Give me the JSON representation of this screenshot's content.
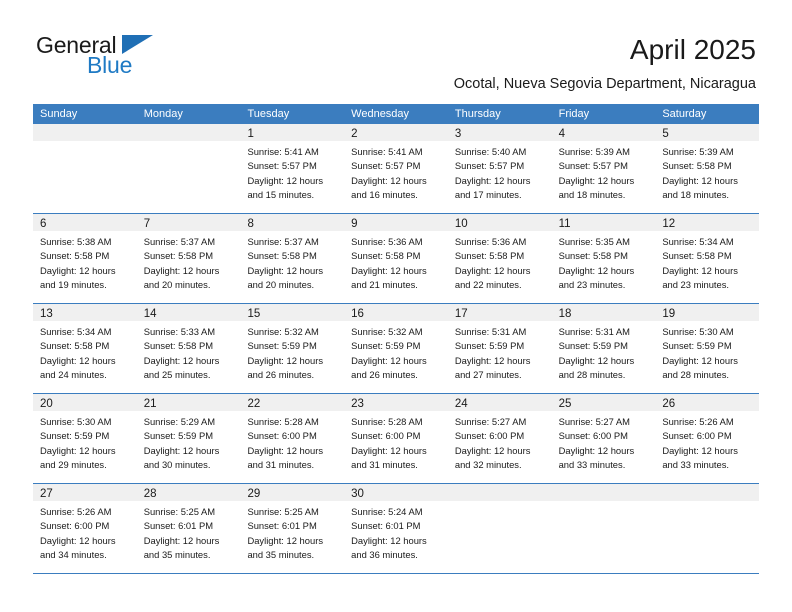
{
  "brand": {
    "name_part1": "General",
    "name_part2": "Blue",
    "triangle_icon": "triangle-icon",
    "color_dark": "#1a1a1a",
    "color_blue": "#1f7ac4"
  },
  "header": {
    "title": "April 2025",
    "subtitle": "Ocotal, Nueva Segovia Department, Nicaragua"
  },
  "theme": {
    "header_blue": "#3b7dbf",
    "daynum_band": "#f0f0f0",
    "text": "#1a1a1a"
  },
  "weekdays": [
    "Sunday",
    "Monday",
    "Tuesday",
    "Wednesday",
    "Thursday",
    "Friday",
    "Saturday"
  ],
  "weeks": [
    [
      {
        "day": "",
        "sunrise": "",
        "sunset": "",
        "daylight1": "",
        "daylight2": ""
      },
      {
        "day": "",
        "sunrise": "",
        "sunset": "",
        "daylight1": "",
        "daylight2": ""
      },
      {
        "day": "1",
        "sunrise": "Sunrise: 5:41 AM",
        "sunset": "Sunset: 5:57 PM",
        "daylight1": "Daylight: 12 hours",
        "daylight2": "and 15 minutes."
      },
      {
        "day": "2",
        "sunrise": "Sunrise: 5:41 AM",
        "sunset": "Sunset: 5:57 PM",
        "daylight1": "Daylight: 12 hours",
        "daylight2": "and 16 minutes."
      },
      {
        "day": "3",
        "sunrise": "Sunrise: 5:40 AM",
        "sunset": "Sunset: 5:57 PM",
        "daylight1": "Daylight: 12 hours",
        "daylight2": "and 17 minutes."
      },
      {
        "day": "4",
        "sunrise": "Sunrise: 5:39 AM",
        "sunset": "Sunset: 5:57 PM",
        "daylight1": "Daylight: 12 hours",
        "daylight2": "and 18 minutes."
      },
      {
        "day": "5",
        "sunrise": "Sunrise: 5:39 AM",
        "sunset": "Sunset: 5:58 PM",
        "daylight1": "Daylight: 12 hours",
        "daylight2": "and 18 minutes."
      }
    ],
    [
      {
        "day": "6",
        "sunrise": "Sunrise: 5:38 AM",
        "sunset": "Sunset: 5:58 PM",
        "daylight1": "Daylight: 12 hours",
        "daylight2": "and 19 minutes."
      },
      {
        "day": "7",
        "sunrise": "Sunrise: 5:37 AM",
        "sunset": "Sunset: 5:58 PM",
        "daylight1": "Daylight: 12 hours",
        "daylight2": "and 20 minutes."
      },
      {
        "day": "8",
        "sunrise": "Sunrise: 5:37 AM",
        "sunset": "Sunset: 5:58 PM",
        "daylight1": "Daylight: 12 hours",
        "daylight2": "and 20 minutes."
      },
      {
        "day": "9",
        "sunrise": "Sunrise: 5:36 AM",
        "sunset": "Sunset: 5:58 PM",
        "daylight1": "Daylight: 12 hours",
        "daylight2": "and 21 minutes."
      },
      {
        "day": "10",
        "sunrise": "Sunrise: 5:36 AM",
        "sunset": "Sunset: 5:58 PM",
        "daylight1": "Daylight: 12 hours",
        "daylight2": "and 22 minutes."
      },
      {
        "day": "11",
        "sunrise": "Sunrise: 5:35 AM",
        "sunset": "Sunset: 5:58 PM",
        "daylight1": "Daylight: 12 hours",
        "daylight2": "and 23 minutes."
      },
      {
        "day": "12",
        "sunrise": "Sunrise: 5:34 AM",
        "sunset": "Sunset: 5:58 PM",
        "daylight1": "Daylight: 12 hours",
        "daylight2": "and 23 minutes."
      }
    ],
    [
      {
        "day": "13",
        "sunrise": "Sunrise: 5:34 AM",
        "sunset": "Sunset: 5:58 PM",
        "daylight1": "Daylight: 12 hours",
        "daylight2": "and 24 minutes."
      },
      {
        "day": "14",
        "sunrise": "Sunrise: 5:33 AM",
        "sunset": "Sunset: 5:58 PM",
        "daylight1": "Daylight: 12 hours",
        "daylight2": "and 25 minutes."
      },
      {
        "day": "15",
        "sunrise": "Sunrise: 5:32 AM",
        "sunset": "Sunset: 5:59 PM",
        "daylight1": "Daylight: 12 hours",
        "daylight2": "and 26 minutes."
      },
      {
        "day": "16",
        "sunrise": "Sunrise: 5:32 AM",
        "sunset": "Sunset: 5:59 PM",
        "daylight1": "Daylight: 12 hours",
        "daylight2": "and 26 minutes."
      },
      {
        "day": "17",
        "sunrise": "Sunrise: 5:31 AM",
        "sunset": "Sunset: 5:59 PM",
        "daylight1": "Daylight: 12 hours",
        "daylight2": "and 27 minutes."
      },
      {
        "day": "18",
        "sunrise": "Sunrise: 5:31 AM",
        "sunset": "Sunset: 5:59 PM",
        "daylight1": "Daylight: 12 hours",
        "daylight2": "and 28 minutes."
      },
      {
        "day": "19",
        "sunrise": "Sunrise: 5:30 AM",
        "sunset": "Sunset: 5:59 PM",
        "daylight1": "Daylight: 12 hours",
        "daylight2": "and 28 minutes."
      }
    ],
    [
      {
        "day": "20",
        "sunrise": "Sunrise: 5:30 AM",
        "sunset": "Sunset: 5:59 PM",
        "daylight1": "Daylight: 12 hours",
        "daylight2": "and 29 minutes."
      },
      {
        "day": "21",
        "sunrise": "Sunrise: 5:29 AM",
        "sunset": "Sunset: 5:59 PM",
        "daylight1": "Daylight: 12 hours",
        "daylight2": "and 30 minutes."
      },
      {
        "day": "22",
        "sunrise": "Sunrise: 5:28 AM",
        "sunset": "Sunset: 6:00 PM",
        "daylight1": "Daylight: 12 hours",
        "daylight2": "and 31 minutes."
      },
      {
        "day": "23",
        "sunrise": "Sunrise: 5:28 AM",
        "sunset": "Sunset: 6:00 PM",
        "daylight1": "Daylight: 12 hours",
        "daylight2": "and 31 minutes."
      },
      {
        "day": "24",
        "sunrise": "Sunrise: 5:27 AM",
        "sunset": "Sunset: 6:00 PM",
        "daylight1": "Daylight: 12 hours",
        "daylight2": "and 32 minutes."
      },
      {
        "day": "25",
        "sunrise": "Sunrise: 5:27 AM",
        "sunset": "Sunset: 6:00 PM",
        "daylight1": "Daylight: 12 hours",
        "daylight2": "and 33 minutes."
      },
      {
        "day": "26",
        "sunrise": "Sunrise: 5:26 AM",
        "sunset": "Sunset: 6:00 PM",
        "daylight1": "Daylight: 12 hours",
        "daylight2": "and 33 minutes."
      }
    ],
    [
      {
        "day": "27",
        "sunrise": "Sunrise: 5:26 AM",
        "sunset": "Sunset: 6:00 PM",
        "daylight1": "Daylight: 12 hours",
        "daylight2": "and 34 minutes."
      },
      {
        "day": "28",
        "sunrise": "Sunrise: 5:25 AM",
        "sunset": "Sunset: 6:01 PM",
        "daylight1": "Daylight: 12 hours",
        "daylight2": "and 35 minutes."
      },
      {
        "day": "29",
        "sunrise": "Sunrise: 5:25 AM",
        "sunset": "Sunset: 6:01 PM",
        "daylight1": "Daylight: 12 hours",
        "daylight2": "and 35 minutes."
      },
      {
        "day": "30",
        "sunrise": "Sunrise: 5:24 AM",
        "sunset": "Sunset: 6:01 PM",
        "daylight1": "Daylight: 12 hours",
        "daylight2": "and 36 minutes."
      },
      {
        "day": "",
        "sunrise": "",
        "sunset": "",
        "daylight1": "",
        "daylight2": ""
      },
      {
        "day": "",
        "sunrise": "",
        "sunset": "",
        "daylight1": "",
        "daylight2": ""
      },
      {
        "day": "",
        "sunrise": "",
        "sunset": "",
        "daylight1": "",
        "daylight2": ""
      }
    ]
  ]
}
